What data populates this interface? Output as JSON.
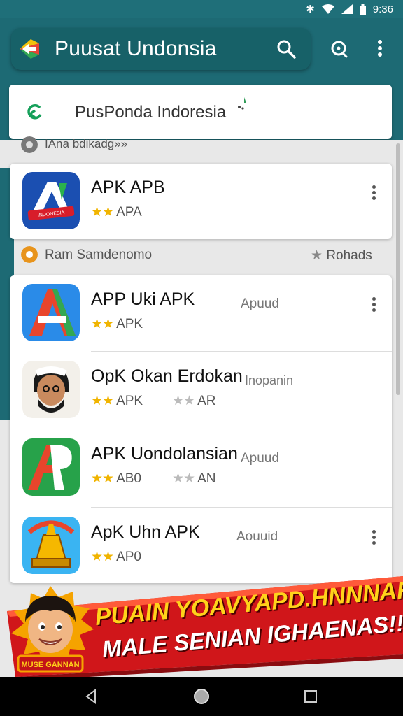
{
  "status": {
    "time": "9:36"
  },
  "appbar": {
    "title": "Puusat Undonsia"
  },
  "search": {
    "query": "PusPonda Indoresia"
  },
  "sections": {
    "first_label": "IAna bdikadg»»",
    "second_label": "Ram Samdenomo",
    "second_action": "Rohads"
  },
  "apps": [
    {
      "name": "APK APB",
      "rating_label": "APA",
      "stars": 2
    },
    {
      "name": "APP Uki APK",
      "rating_label": "APK",
      "stars": 2,
      "tag": "Apuud"
    },
    {
      "name": "OpK Okan Erdokan",
      "rating_label": "APK",
      "stars": 2,
      "tag": "Inopanin",
      "second_rating_label": "AR"
    },
    {
      "name": "APK Uondolansian",
      "rating_label": "AB0",
      "stars": 2,
      "tag": "Apuud",
      "second_rating_label": "AN"
    },
    {
      "name": "ApK Uhn APK",
      "rating_label": "AP0",
      "stars": 2,
      "tag": "Aouuid"
    }
  ],
  "banner": {
    "line1": "PUAIN YOAVYAPD.HNNNAR",
    "line2": "MALE SENIAN IGHAENAS!!",
    "badge_text": "MUSE GANNAN"
  },
  "icons": [
    "app-logo-icon",
    "search-icon",
    "lens-icon",
    "more-vert-icon",
    "back-icon",
    "sparkle-icon",
    "star-icon",
    "nav-back-icon",
    "nav-home-icon",
    "nav-recents-icon"
  ],
  "colors": {
    "teal": "#1d6a74",
    "star": "#f0b400",
    "banner_red": "#d0161a",
    "banner_yellow": "#ffd21a"
  }
}
